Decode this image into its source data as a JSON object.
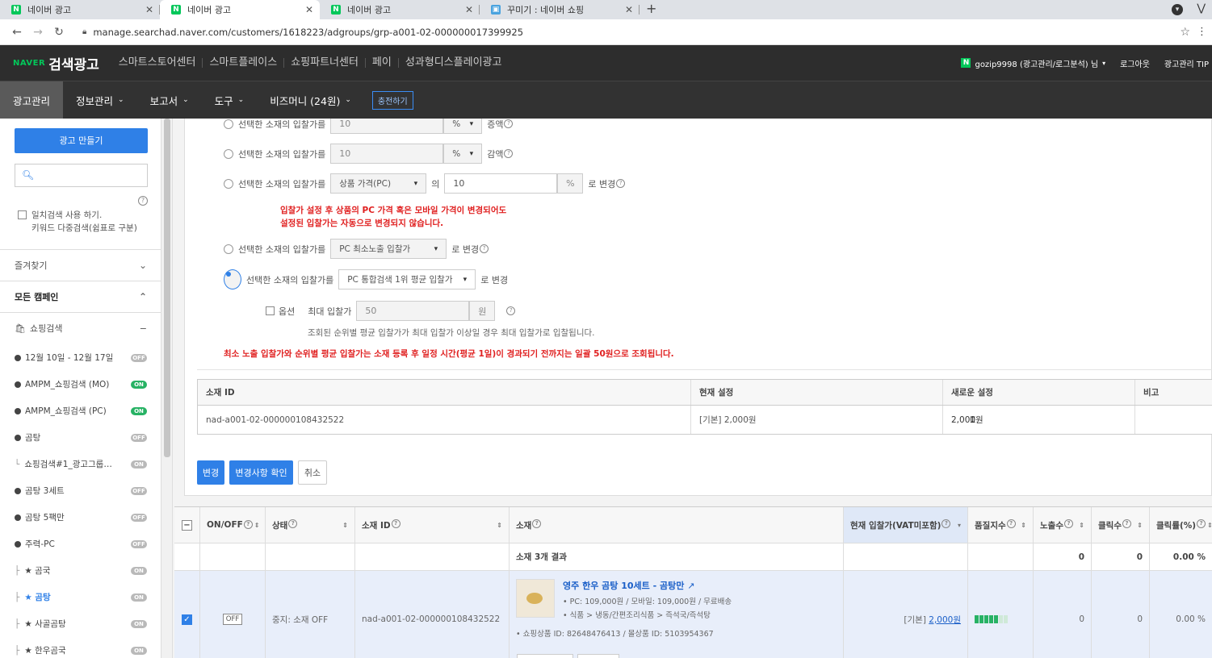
{
  "browser": {
    "tabs": [
      {
        "label": "네이버 광고",
        "active": false
      },
      {
        "label": "네이버 광고",
        "active": true
      },
      {
        "label": "네이버 광고",
        "active": false
      },
      {
        "label": "꾸미기 : 네이버 쇼핑",
        "active": false
      }
    ],
    "new_tab": "+",
    "url": "manage.searchad.naver.com/customers/1618223/adgroups/grp-a001-02-000000017399925"
  },
  "header": {
    "brand_small": "NAVER",
    "brand_service": "검색광고",
    "top_links": [
      "스마트스토어센터",
      "스마트플레이스",
      "쇼핑파트너센터",
      "페이",
      "성과형디스플레이광고"
    ],
    "user": "gozip9998 (광고관리/로그분석) 님",
    "logout": "로그아웃",
    "tip": "광고관리 TIP"
  },
  "mainnav": {
    "items": [
      "광고관리",
      "정보관리",
      "보고서",
      "도구",
      "비즈머니 (24원)"
    ],
    "charge": "충전하기"
  },
  "sidebar": {
    "make_ad": "광고 만들기",
    "search_placeholder": "",
    "exact_line1": "일치검색 사용 하기.",
    "exact_line2": "키워드 다중검색(쉼표로 구분)",
    "favorites": "즐겨찾기",
    "all_campaigns": "모든 캠페인",
    "shopping": "쇼핑검색",
    "collapse": "−",
    "campaigns": [
      {
        "name": "12월 10일 - 12월 17일",
        "status": "OFF"
      },
      {
        "name": "AMPM_쇼핑검색 (MO)",
        "status": "ON"
      },
      {
        "name": "AMPM_쇼핑검색 (PC)",
        "status": "ON"
      },
      {
        "name": "곰탕",
        "status": "OFF"
      },
      {
        "name": "쇼핑검색#1_광고그룹…",
        "status": "ON"
      },
      {
        "name": "곰탕 3세트",
        "status": "OFF"
      },
      {
        "name": "곰탕 5팩만",
        "status": "OFF"
      },
      {
        "name": "주력-PC",
        "status": "OFF"
      },
      {
        "name": "★ 곰국",
        "status": "ON"
      },
      {
        "name": "★ 곰탕",
        "status": "ON"
      },
      {
        "name": "★ 사골곰탕",
        "status": "ON"
      },
      {
        "name": "★ 한우곰국",
        "status": "ON"
      }
    ]
  },
  "bidform": {
    "opt_label": "선택한 소재의 입찰가를",
    "r1_value": "10",
    "r1_unit": "%",
    "r1_suffix": "증액",
    "r2_value": "10",
    "r2_unit": "%",
    "r2_suffix": "감액",
    "r3_select": "상품 가격(PC)",
    "r3_of": "의",
    "r3_value": "10",
    "r3_unit": "%",
    "r3_suffix": "로 변경",
    "warn1": "입찰가 설정 후 상품의 PC 가격 혹은 모바일 가격이 변경되어도",
    "warn2": "설정된 입찰가는 자동으로 변경되지 않습니다.",
    "r4_select": "PC 최소노출 입찰가",
    "r4_suffix": "로 변경",
    "r5_select": "PC 통합검색 1위 평균 입찰가",
    "r5_suffix": "로 변경",
    "option_label": "옵션",
    "max_bid_label": "최대 입찰가",
    "max_bid_value": "50",
    "max_bid_unit": "원",
    "note": "조회된 순위별 평균 입찰가가 최대 입찰가 이상일 경우 최대 입찰가로 입찰됩니다.",
    "red_note": "최소 노출 입찰가와 순위별 평균 입찰가는 소재 등록 후 일정 시간(평균 1일)이 경과되기 전까지는 일괄 50원으로 조회됩니다."
  },
  "change_table": {
    "headers": [
      "소재 ID",
      "현재 설정",
      "새로운 설정",
      "비고"
    ],
    "row": {
      "id": "nad-a001-02-000000108432522",
      "current": "[기본]   2,000원",
      "new": "2,000원",
      "note": ""
    }
  },
  "actions": {
    "change": "변경",
    "confirm": "변경사항 확인",
    "cancel": "취소"
  },
  "grid": {
    "headers": [
      "ON/OFF",
      "상태",
      "소재 ID",
      "소재",
      "현재 입찰가(VAT미포함)",
      "품질지수",
      "노출수",
      "클릭수",
      "클릭률(%)"
    ],
    "summary": {
      "label": "소재 3개 결과",
      "impressions": "0",
      "clicks": "0",
      "ctr": "0.00 %"
    },
    "row": {
      "onoff": "OFF",
      "status": "중지: 소재 OFF",
      "id": "nad-a001-02-000000108432522",
      "title": "영주 한우 곰탕 10세트 - 곰탕만",
      "line1": "• PC: 109,000원  /  모바일: 109,000원  /  무료배송",
      "line2": "• 식품 > 냉동/간편조리식품 > 즉석국/즉석탕",
      "line3": "• 쇼핑상품 ID: 82648476413    / 몰상품 ID: 5103954367",
      "bid_prefix": "[기본]",
      "bid": "2,000원",
      "quality": 5,
      "quality_max": 7,
      "impressions": "0",
      "clicks": "0",
      "ctr": "0.00 %"
    }
  },
  "colors": {
    "accent": "#2f80e7",
    "on": "#27b264",
    "off": "#b9b9b9",
    "warn": "#e02020"
  }
}
